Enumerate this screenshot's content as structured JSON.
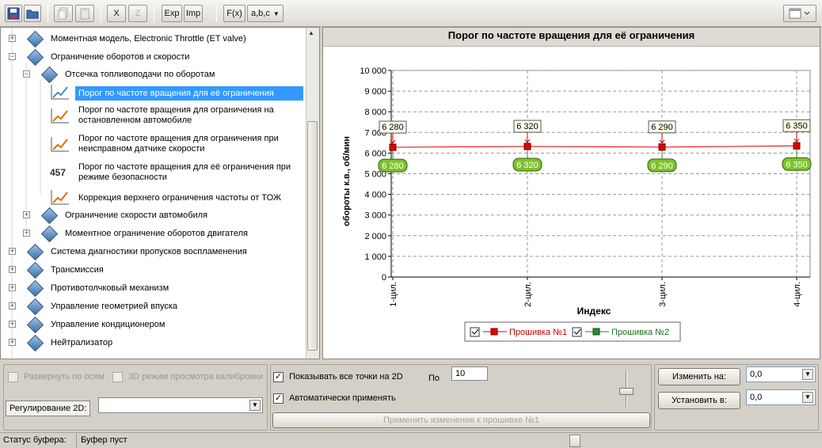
{
  "toolbar": {
    "btn_x": "X",
    "btn_z": "Z",
    "btn_exp": "Exp",
    "btn_imp": "Imp",
    "btn_fx": "F(x)",
    "btn_abc": "a,b,c"
  },
  "tree": {
    "items": [
      {
        "label": "Моментная модель, Electronic Throttle (ET valve)"
      },
      {
        "label": "Ограничение оборотов и скорости"
      },
      {
        "label": "Отсечка топливоподачи по оборотам"
      },
      {
        "label": "Порог по частоте вращения для её ограничения"
      },
      {
        "label": "Порог по частоте вращения для ограничения на",
        "label2": "остановленном автомобиле"
      },
      {
        "label": "Порог по частоте вращения для ограничения при",
        "label2": "неисправном датчике скорости"
      },
      {
        "label": "Порог по частоте вращения для её ограничения при",
        "label2": "режиме безопасности",
        "badge": "457"
      },
      {
        "label": "Коррекция верхнего ограничения частоты от ТОЖ"
      },
      {
        "label": "Ограничение скорости автомобиля"
      },
      {
        "label": "Моментное ограничение оборотов двигателя"
      },
      {
        "label": "Система диагностики пропусков воспламенения"
      },
      {
        "label": "Трансмиссия"
      },
      {
        "label": "Противотолчковый механизм"
      },
      {
        "label": "Управление геометрией впуска"
      },
      {
        "label": "Управление кондиционером"
      },
      {
        "label": "Нейтрализатор"
      }
    ]
  },
  "chart_data": {
    "type": "line",
    "title": "Порог по частоте вращения для её ограничения",
    "xlabel": "Индекс",
    "ylabel": "обороты к.в., об/мин",
    "categories": [
      "1-цил.",
      "2-цил.",
      "3-цил.",
      "4-цил."
    ],
    "ylim": [
      0,
      10000
    ],
    "yticks": [
      "0",
      "1 000",
      "2 000",
      "3 000",
      "4 000",
      "5 000",
      "6 000",
      "7 000",
      "8 000",
      "9 000",
      "10 000"
    ],
    "grid": true,
    "series": [
      {
        "name": "Прошивка №1",
        "values": [
          6280,
          6320,
          6290,
          6350
        ],
        "labels": [
          "6 280",
          "6 320",
          "6 290",
          "6 350"
        ],
        "color": "#e00000"
      },
      {
        "name": "Прошивка №2",
        "values": [
          6280,
          6320,
          6290,
          6350
        ],
        "labels": [
          "6 280",
          "6 320",
          "6 290",
          "6 350"
        ],
        "color": "#2f8a2f"
      }
    ],
    "legend": "bottom"
  },
  "bottom": {
    "expand_axes": "Развернуть по осям",
    "mode_3d": "3D режим просмотра калибровки",
    "reg2d_label": "Регулирование 2D:",
    "show_all_points": "Показывать все точки на 2D",
    "po_label": "По",
    "po_value": "10",
    "auto_apply": "Автоматически применять",
    "apply_btn": "Применить изменения к прошивке №1",
    "change_by_btn": "Изменить на:",
    "change_by_value": "0,0",
    "set_to_btn": "Установить в:",
    "set_to_value": "0,0"
  },
  "status": {
    "label": "Статус буфера:",
    "value": "Буфер пуст"
  },
  "colors": {
    "selection": "#3399ff",
    "series1": "#e00000",
    "series2": "#2f8a2f"
  }
}
